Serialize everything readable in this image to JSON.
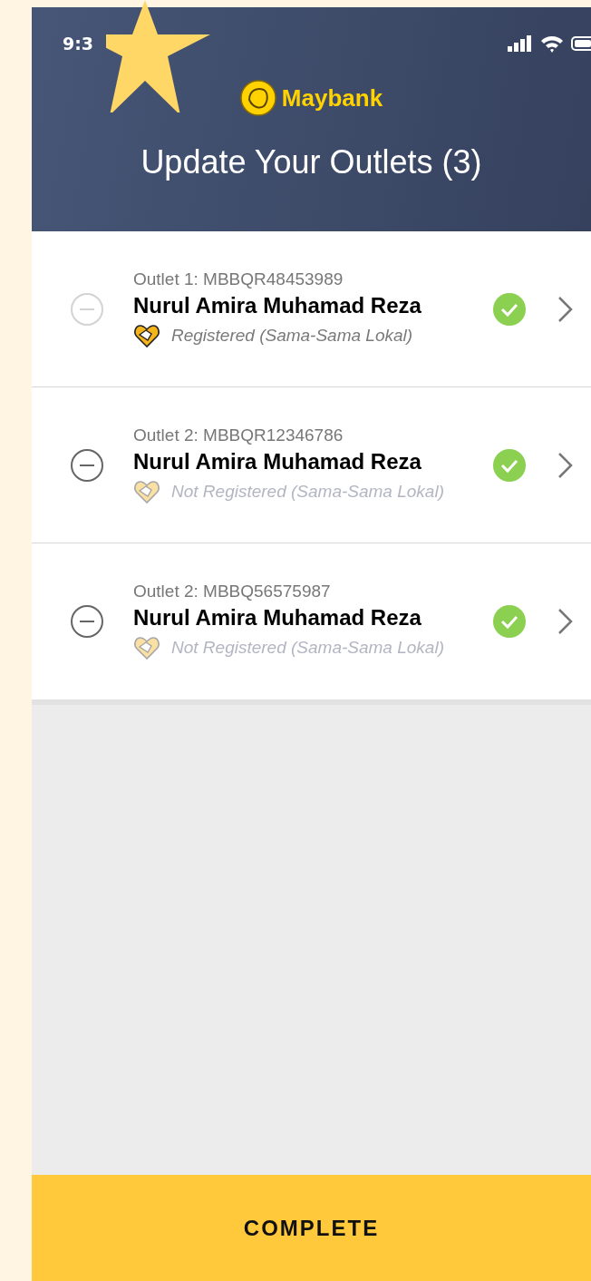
{
  "status_bar": {
    "time": "9:3"
  },
  "header": {
    "brand": "Maybank",
    "title": "Update Your Outlets (3)"
  },
  "outlets": [
    {
      "label": "Outlet 1: MBBQR48453989",
      "name": "Nurul Amira Muhamad Reza",
      "status": "Registered (Sama-Sama Lokal)",
      "registered": true,
      "remove_disabled": true,
      "verified": true
    },
    {
      "label": "Outlet 2: MBBQR12346786",
      "name": "Nurul Amira Muhamad Reza",
      "status": "Not Registered (Sama-Sama Lokal)",
      "registered": false,
      "remove_disabled": false,
      "verified": true
    },
    {
      "label": "Outlet 2: MBBQ56575987",
      "name": "Nurul Amira Muhamad Reza",
      "status": "Not Registered (Sama-Sama Lokal)",
      "registered": false,
      "remove_disabled": false,
      "verified": true
    }
  ],
  "footer": {
    "button": "COMPLETE"
  }
}
